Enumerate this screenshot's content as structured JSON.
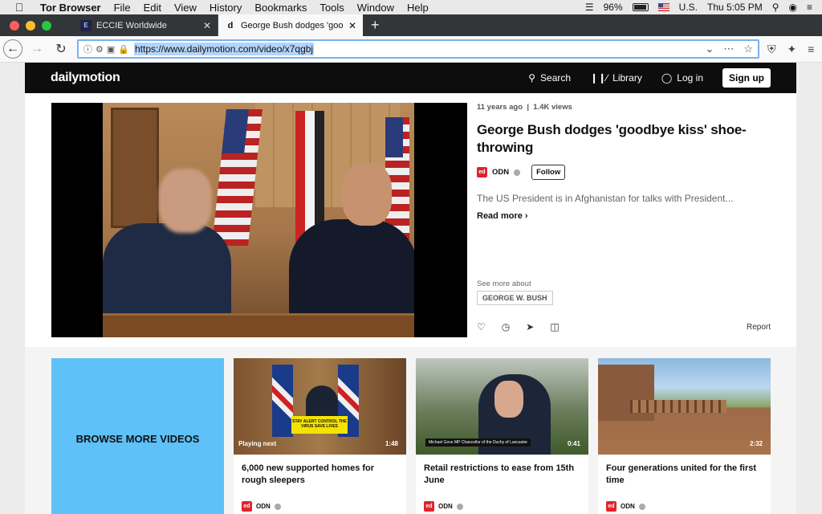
{
  "menubar": {
    "app": "Tor Browser",
    "items": [
      "File",
      "Edit",
      "View",
      "History",
      "Bookmarks",
      "Tools",
      "Window",
      "Help"
    ],
    "battery": "96%",
    "input_source": "U.S.",
    "clock": "Thu 5:05 PM"
  },
  "tabs": [
    {
      "title": "ECCIE Worldwide",
      "favicon": "eccie-icon",
      "active": false
    },
    {
      "title": "George Bush dodges 'goodbye",
      "favicon": "d",
      "active": true
    }
  ],
  "address": {
    "url": "https://www.dailymotion.com/video/x7qgbj"
  },
  "site": {
    "logo": "dailymotion",
    "nav": {
      "search": "Search",
      "library": "Library",
      "login": "Log in",
      "signup": "Sign up"
    }
  },
  "video": {
    "age": "11 years ago",
    "separator": "|",
    "views": "1.4K views",
    "title": "George Bush dodges 'goodbye kiss' shoe-throwing",
    "channel": "ODN",
    "channel_logo": "ed",
    "follow": "Follow",
    "description": "The US President is in Afghanistan for talks with President...",
    "read_more": "Read more",
    "see_more": "See more about",
    "tag": "GEORGE W. BUSH",
    "report": "Report"
  },
  "browse": {
    "label": "BROWSE MORE VIDEOS"
  },
  "cards": [
    {
      "title": "6,000 new supported homes for rough sleepers",
      "duration": "1:48",
      "badge": "Playing next",
      "channel": "ODN",
      "overlay": "STAY ALERT  CONTROL THE VIRUS  SAVE LIVES"
    },
    {
      "title": "Retail restrictions to ease from 15th June",
      "duration": "0:41",
      "badge": "",
      "channel": "ODN",
      "overlay": "Michael Gove MP  Chancellor of the Duchy of Lancaster"
    },
    {
      "title": "Four generations united for the first time",
      "duration": "2:32",
      "badge": "",
      "channel": "ODN",
      "overlay": ""
    }
  ],
  "colors": {
    "accent": "#5ec1f8",
    "sitebar": "#0d0d0d",
    "channel_red": "#e0242b"
  }
}
